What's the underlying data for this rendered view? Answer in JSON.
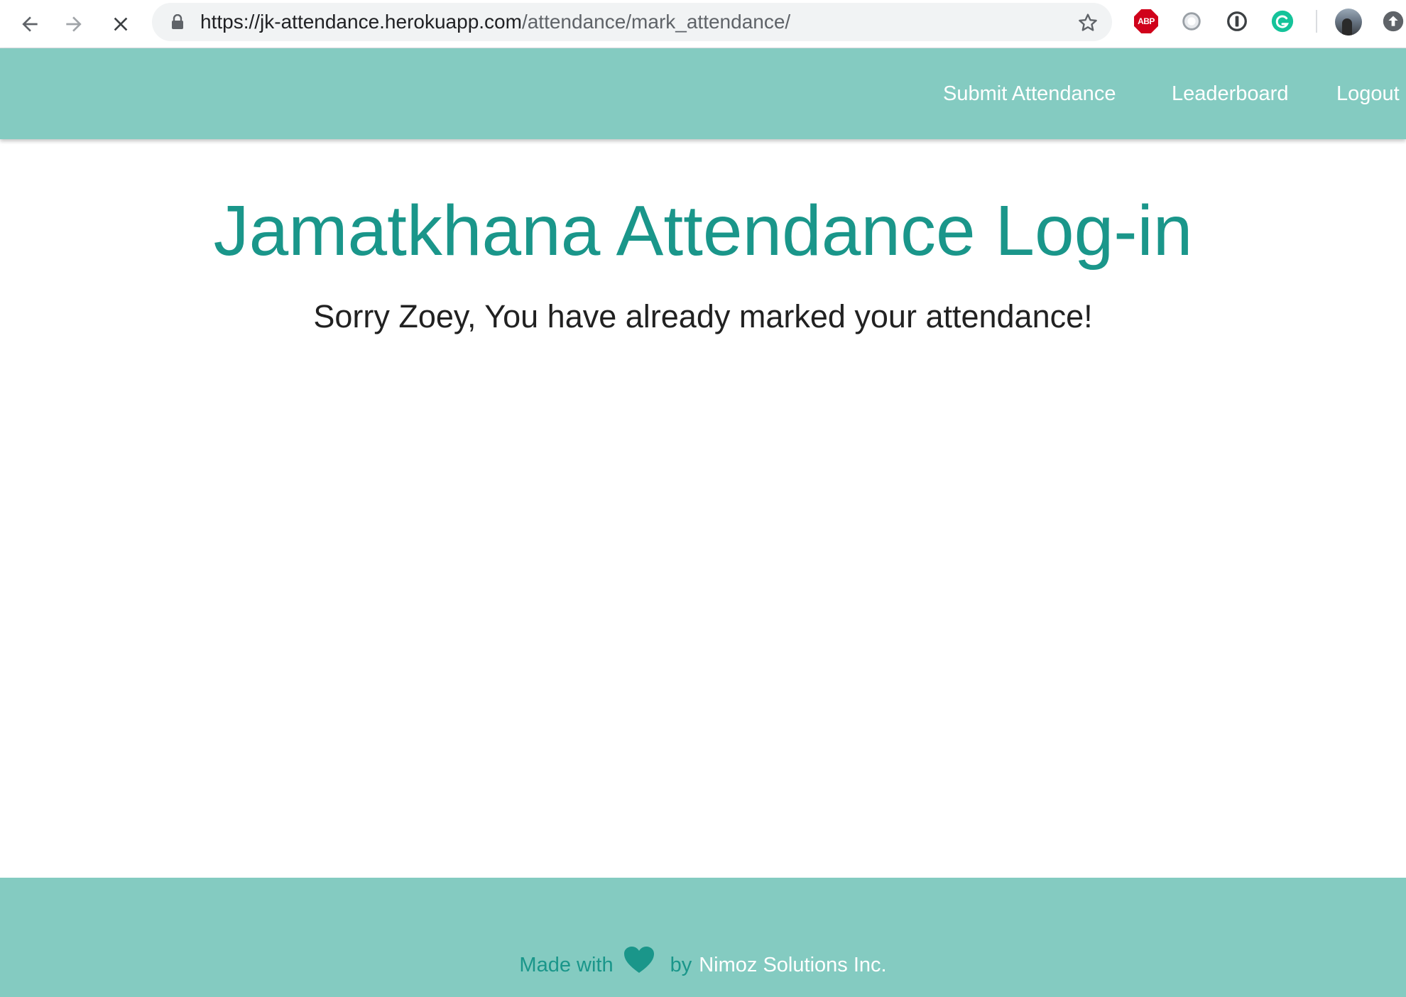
{
  "browser": {
    "url_host": "https://jk-attendance.herokuapp.com",
    "url_path": "/attendance/mark_attendance/",
    "extensions": [
      "ABP"
    ],
    "icons": [
      "back-arrow-icon",
      "forward-arrow-icon",
      "stop-loading-icon",
      "lock-icon",
      "star-icon",
      "adblock-icon",
      "extension-circle-icon",
      "password-manager-icon",
      "grammarly-icon",
      "profile-avatar",
      "update-arrow-icon"
    ]
  },
  "navbar": {
    "links": {
      "submit_attendance": "Submit Attendance",
      "leaderboard": "Leaderboard",
      "logout": "Logout"
    },
    "color": "#84cbc1"
  },
  "main": {
    "title": "Jamatkhana Attendance Log-in",
    "message": "Sorry Zoey, You have already marked your attendance!",
    "title_color": "#1a968a"
  },
  "footer": {
    "made_with": "Made with",
    "by": "by",
    "company": "Nimoz Solutions Inc.",
    "icon": "heart-icon"
  }
}
